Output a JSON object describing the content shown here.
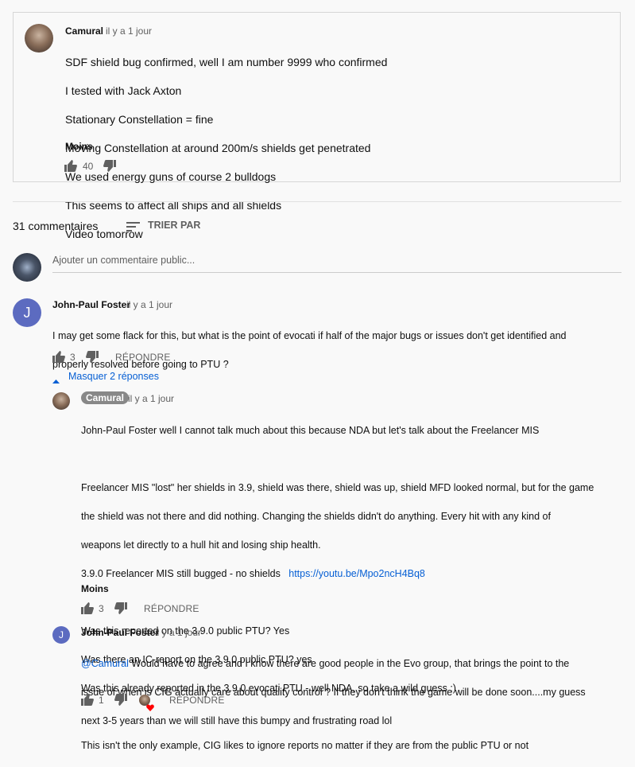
{
  "pinned": {
    "author": "Camural",
    "time": "il y a 1 jour",
    "lines": [
      "SDF shield bug confirmed, well I am number 9999 who confirmed",
      "I tested with Jack Axton",
      "Stationary Constellation = fine",
      "Moving Constellation at around 200m/s  shields get penetrated",
      "We used energy guns of course  2 bulldogs",
      "This seems to affect all ships and all shields",
      "Video tomorrow"
    ],
    "more": "Moins",
    "likes": "40"
  },
  "header": {
    "count_label": "31 commentaires",
    "sort_label": "TRIER PAR"
  },
  "compose": {
    "placeholder": "Ajouter un commentaire public..."
  },
  "comment1": {
    "avatar_letter": "J",
    "author": "John-Paul Foster",
    "time": "il y a 1 jour",
    "line1": "I may get some flack for this, but what is the point of evocati if half of the major bugs or issues don't get identified and",
    "line2": "properly resolved before going to PTU ?",
    "likes": "3",
    "reply": "RÉPONDRE",
    "toggle": "Masquer 2 réponses"
  },
  "reply1": {
    "author": "Camural",
    "time": "il y a 1 jour",
    "l1": "John-Paul Foster well I cannot talk much about this because NDA but let's talk about the Freelancer MIS",
    "l2": "Freelancer MIS \"lost\" her shields in 3.9, shield was there, shield was up, shield MFD looked normal, but for the game",
    "l3": "the shield was not there and did nothing. Changing the shields didn't do anything. Every hit with any kind of",
    "l4": "weapons let directly to a hull hit and losing ship health.",
    "l5": "3.9.0 Freelancer MIS still bugged - no shields",
    "link": "https://youtu.be/Mpo2ncH4Bq8",
    "l6": "Was this reported on the 3.9.0 public PTU? Yes",
    "l7": "Was there an IC-report on the 3.9.0 public PTU? yes",
    "l8": "Was this already reported in the 3.9.0 evocati PTU  - well NDA, so take a wild guess :)",
    "l9": "This isn't the only example, CIG likes to ignore reports no matter if they are from the public PTU or not",
    "more": "Moins",
    "likes": "3",
    "reply": "RÉPONDRE"
  },
  "reply2": {
    "avatar_letter": "J",
    "author": "John-Paul Foster",
    "time": "il y a 1 jour",
    "mention": "@Camural",
    "l1": "  Would have to agree and I know there are good people in the Evo group, that brings the point to the",
    "l2": "issue of when is CIG actually care about quality control ? If they don't think the game will be done soon....my guess",
    "l3": "next 3-5 years than we will still have this bumpy and frustrating road lol",
    "likes": "1",
    "reply": "RÉPONDRE"
  },
  "colors": {
    "avatar_blue": "#5c6bc0",
    "link_blue": "#065fd4",
    "heart_red": "#ff0000"
  }
}
